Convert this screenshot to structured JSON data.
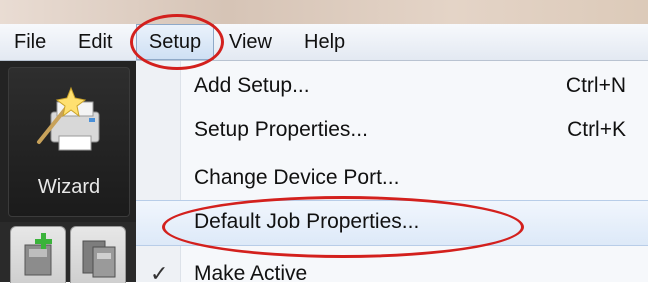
{
  "menubar": {
    "items": [
      {
        "label": "File"
      },
      {
        "label": "Edit"
      },
      {
        "label": "Setup"
      },
      {
        "label": "View"
      },
      {
        "label": "Help"
      }
    ]
  },
  "toolbar": {
    "wizard_label": "Wizard",
    "wizard_icon": "wizard-printer-icon",
    "tab_icons": [
      "add-device-icon",
      "device-icon"
    ]
  },
  "dropdown": {
    "items": [
      {
        "label": "Add Setup...",
        "shortcut": "Ctrl+N"
      },
      {
        "label": "Setup Properties...",
        "shortcut": "Ctrl+K"
      },
      {
        "label": "Change Device Port..."
      },
      {
        "label": "Default Job Properties..."
      },
      {
        "label": "Make Active",
        "checked": true
      }
    ]
  },
  "colors": {
    "annotation_ring": "#d3201d",
    "highlight": "#dde9f8",
    "toolbar_bg": "#232323"
  }
}
